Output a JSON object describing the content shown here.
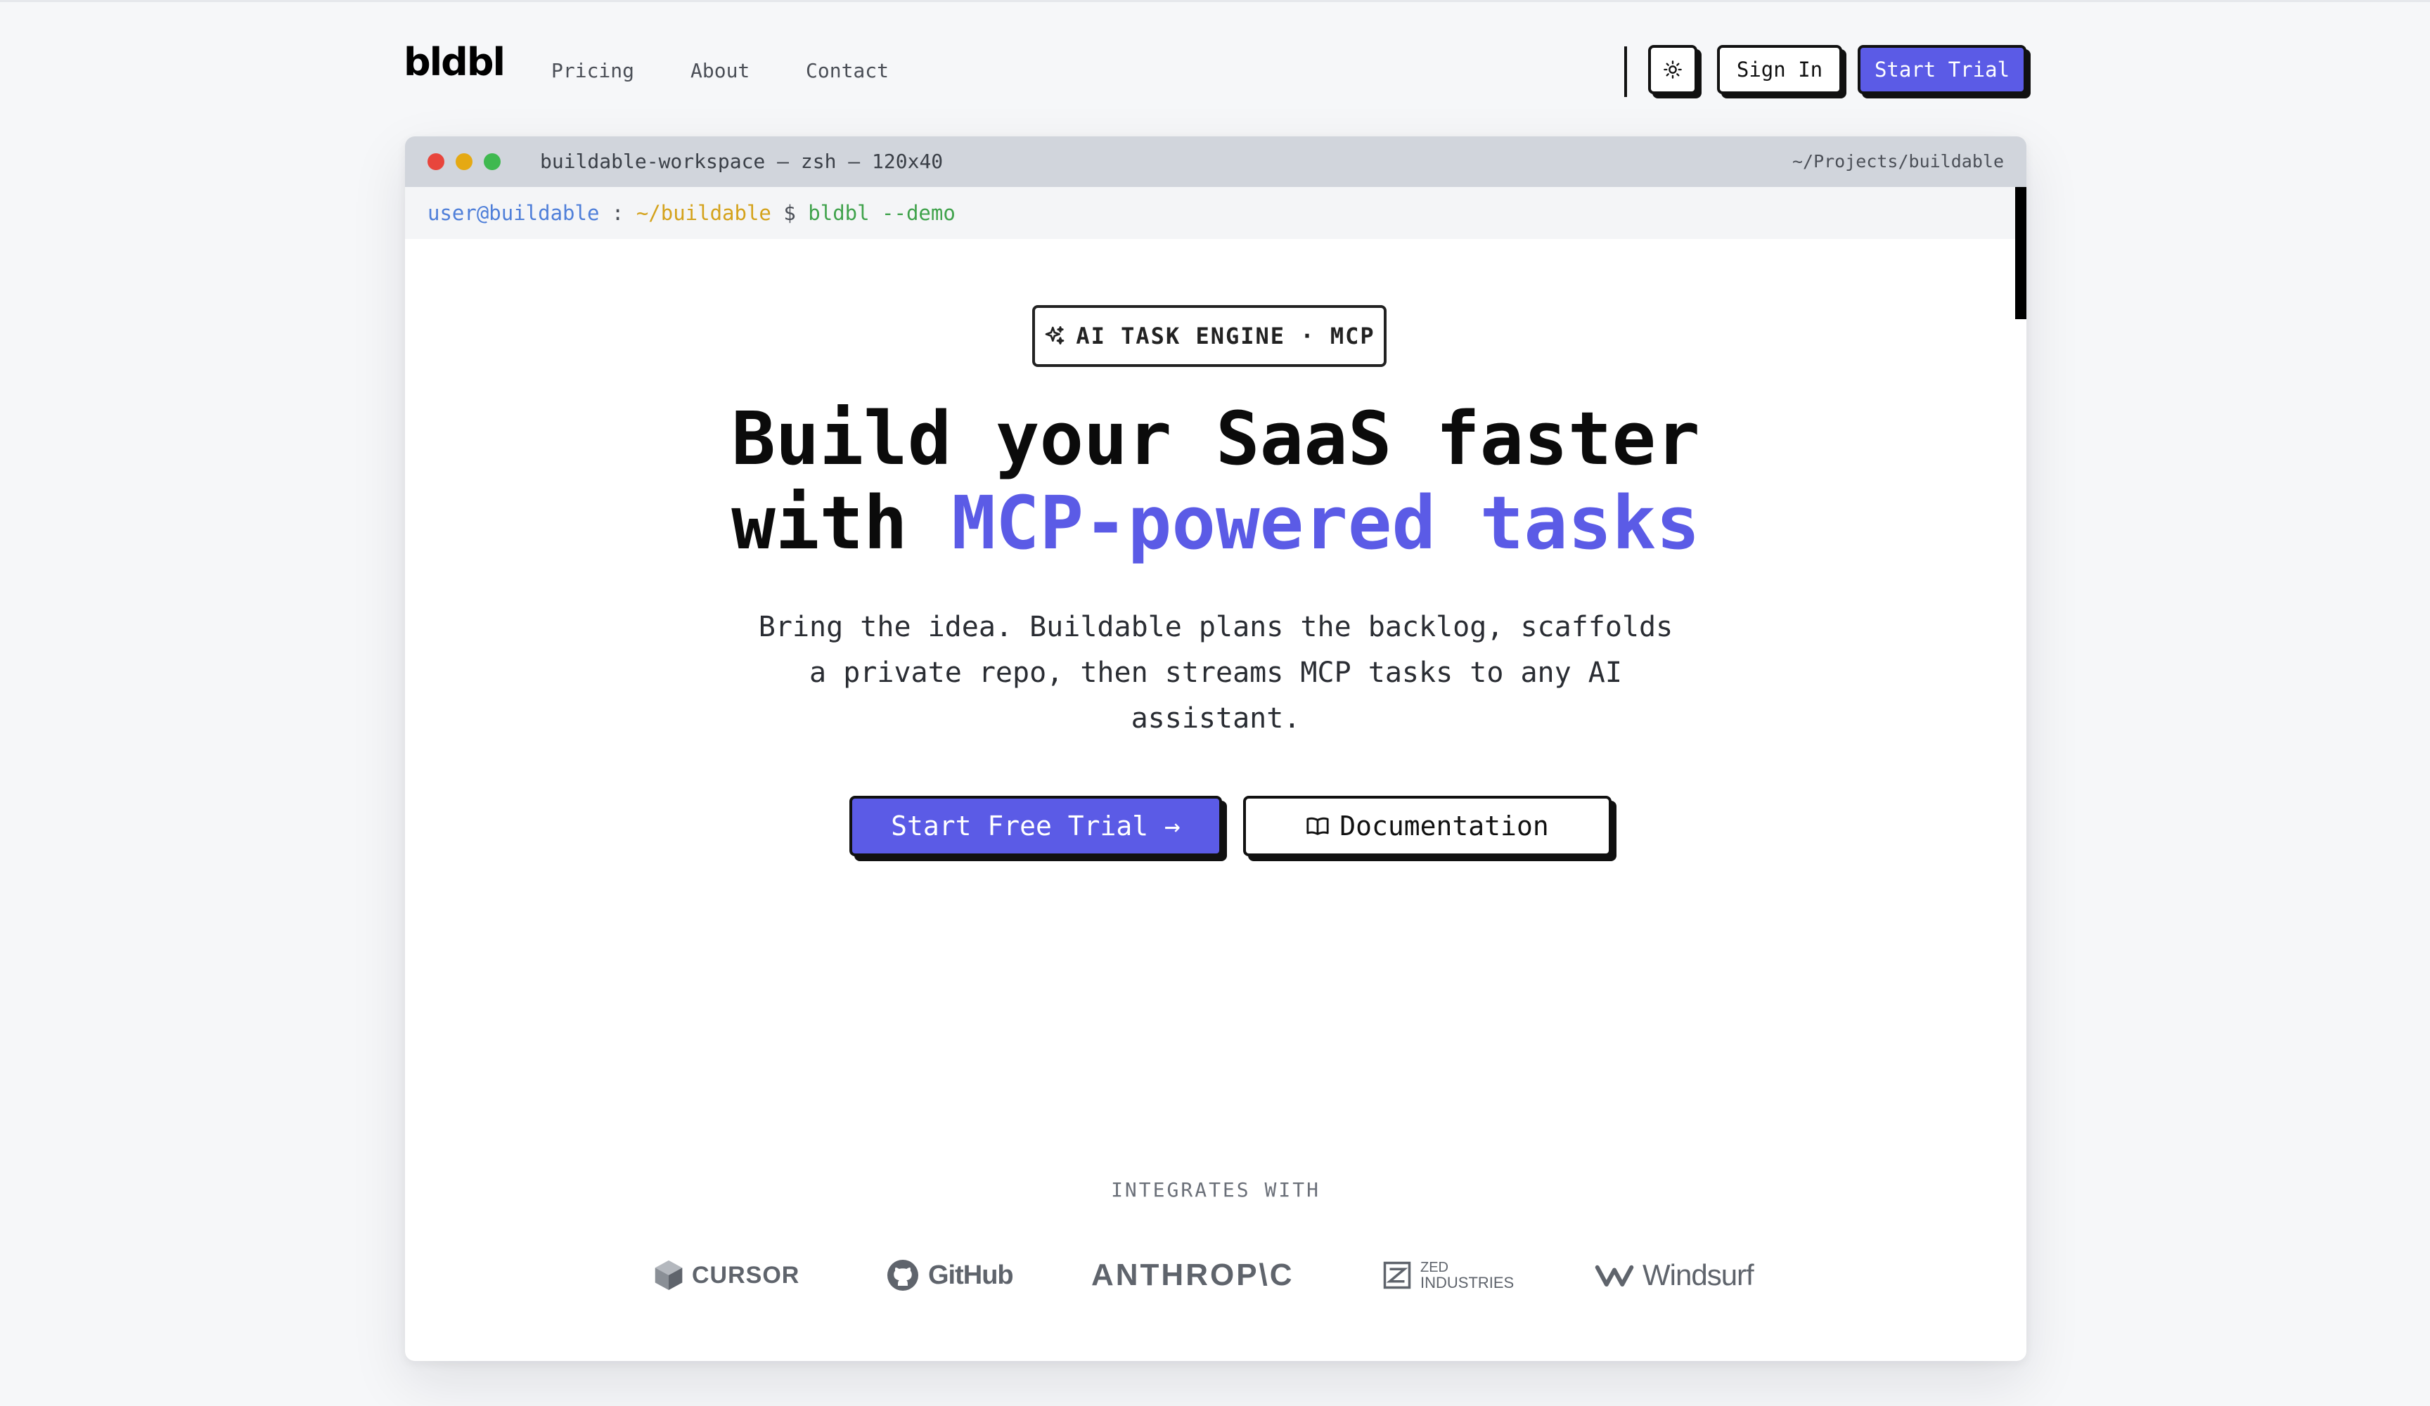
{
  "nav": {
    "logo": "bldbl",
    "links": [
      "Pricing",
      "About",
      "Contact"
    ],
    "theme_icon": "sun-icon",
    "sign_in": "Sign In",
    "start_trial": "Start Trial"
  },
  "window": {
    "title": "buildable-workspace — zsh — 120x40",
    "path": "~/Projects/buildable",
    "prompt": {
      "user": "user@buildable",
      "sep": " : ",
      "path": "~/buildable",
      "dollar": " $ ",
      "command": "bldbl --demo"
    }
  },
  "hero": {
    "badge": "AI TASK ENGINE · MCP",
    "headline_line1": "Build your SaaS faster",
    "headline_line2_prefix": "with ",
    "headline_line2_accent": "MCP-powered tasks",
    "subtext_line1": "Bring the idea. Buildable plans the backlog, scaffolds",
    "subtext_line2": "a private repo, then streams MCP tasks to any AI",
    "subtext_line3": "assistant.",
    "cta_primary": "Start Free Trial →",
    "cta_secondary": "Documentation"
  },
  "integrations": {
    "heading": "INTEGRATES WITH",
    "brands": {
      "cursor": "CURSOR",
      "github": "GitHub",
      "anthropic": "ANTHROP\\C",
      "zed_top": "ZED",
      "zed_bottom": "INDUSTRIES",
      "windsurf": "Windsurf"
    }
  },
  "colors": {
    "accent": "#5b5be6",
    "prompt_user": "#4f7fd9",
    "prompt_path": "#d4a21b",
    "prompt_cmd": "#3fa24b"
  }
}
